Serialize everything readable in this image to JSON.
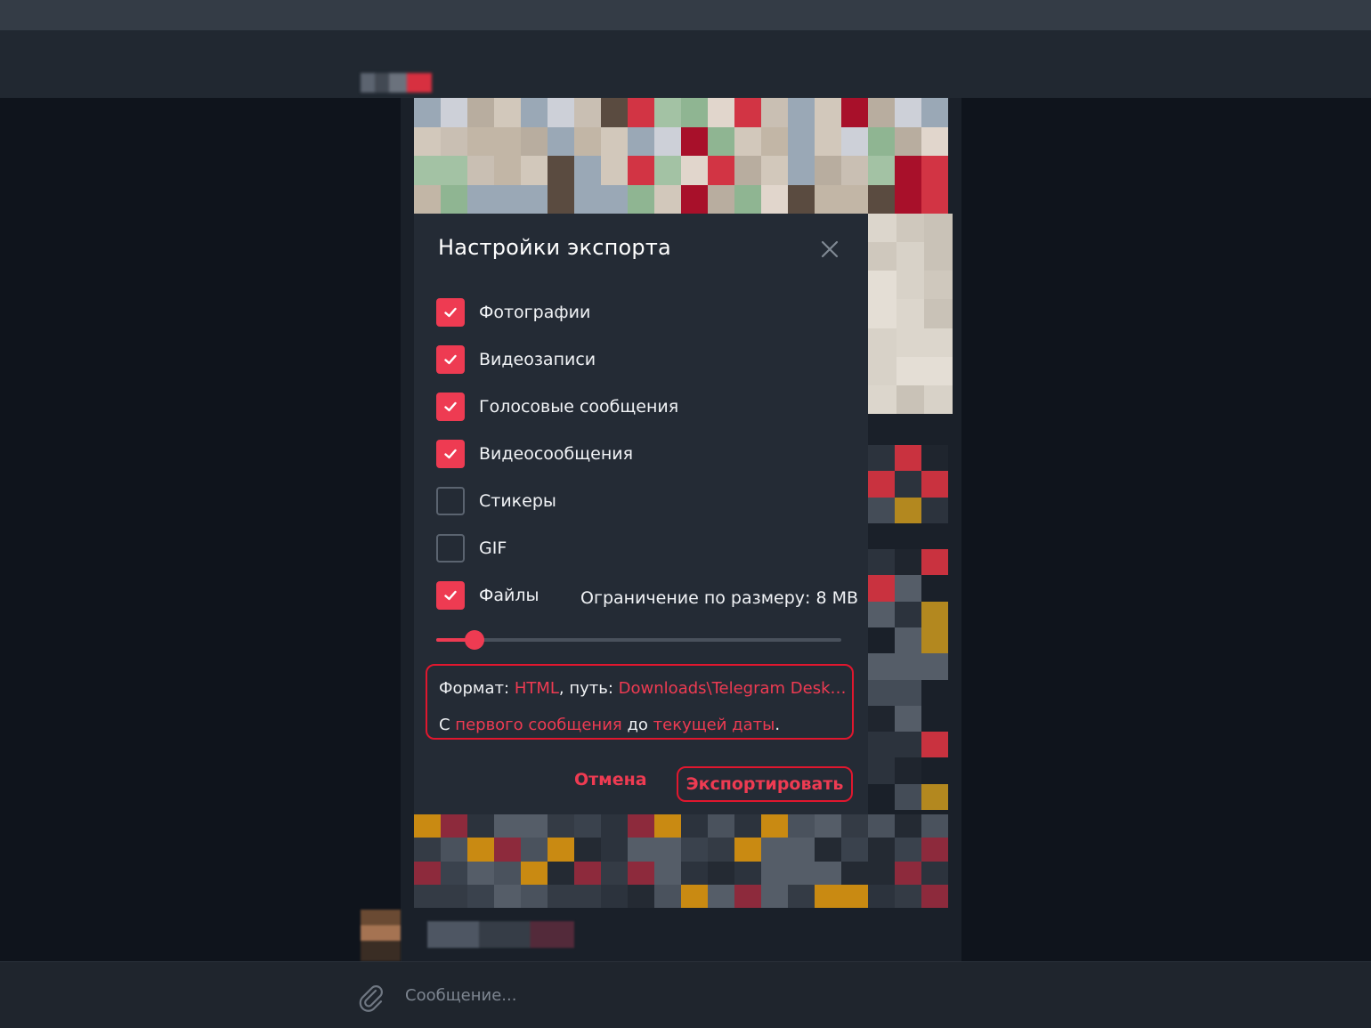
{
  "header": {
    "chat_name": "",
    "chat_status": ""
  },
  "dialog": {
    "title": "Настройки экспорта",
    "options": [
      {
        "label": "Фотографии",
        "checked": true
      },
      {
        "label": "Видеозаписи",
        "checked": true
      },
      {
        "label": "Голосовые сообщения",
        "checked": true
      },
      {
        "label": "Видеосообщения",
        "checked": true
      },
      {
        "label": "Стикеры",
        "checked": false
      },
      {
        "label": "GIF",
        "checked": false
      },
      {
        "label": "Файлы",
        "checked": true
      }
    ],
    "size_limit_label": "Ограничение по размеру: 8 MB",
    "size_slider_fraction": 0.09,
    "format_prefix": "Формат: ",
    "format_value": "HTML",
    "path_prefix": ", путь: ",
    "path_value": "Downloads\\Telegram Deskt...",
    "range_prefix": "С ",
    "range_from": "первого сообщения",
    "range_mid": " до ",
    "range_to": "текущей даты",
    "range_suffix": ".",
    "cancel_label": "Отмена",
    "export_label": "Экспортировать"
  },
  "compose": {
    "placeholder": "Сообщение..."
  },
  "colors": {
    "accent": "#ee3b52",
    "highlight_outline": "#e0172e",
    "dialog_bg": "#242b35",
    "page_bg": "#0f141c"
  }
}
